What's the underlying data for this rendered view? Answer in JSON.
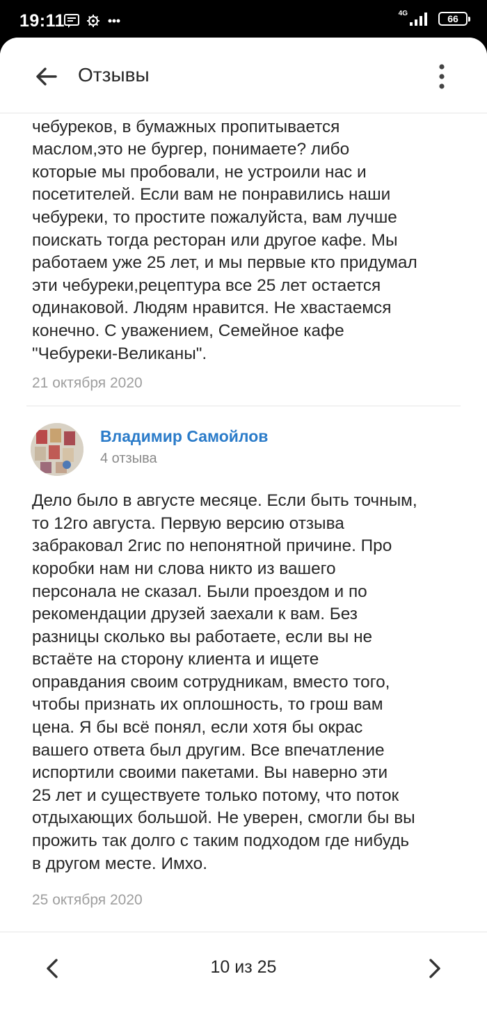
{
  "status_bar": {
    "time": "19:11",
    "network": "4G",
    "battery": "66"
  },
  "header": {
    "title": "Отзывы"
  },
  "reply": {
    "text": "класть, на газету? Нет таких тар больших для\nчебуреков, в бумажных пропитывается\nмаслом,это не бургер, понимаете? либо\nкоторые мы пробовали, не устроили нас и\nпосетителей. Если вам не понравились наши\nчебуреки, то простите пожалуйста, вам лучше\nпоискать тогда ресторан или другое кафе. Мы\nработаем уже 25 лет, и мы первые кто придумал\nэти чебуреки,рецептура все 25 лет остается\nодинаковой. Людям нравится. Не хвастаемся\nконечно. С уважением, Семейное кафе\n\"Чебуреки-Великаны\".",
    "date": "21 октября 2020"
  },
  "review": {
    "author": "Владимир Самойлов",
    "review_count": "4 отзыва",
    "text": "Дело было в августе месяце. Если быть точным,\nто 12го августа. Первую версию отзыва\nзабраковал 2гис по непонятной причине. Про\nкоробки нам ни слова никто из вашего\nперсонала не сказал. Были проездом и по\nрекомендации друзей заехали к вам. Без\nразницы сколько вы работаете, если вы не\nвстаёте на сторону клиента и ищете\nоправдания своим сотрудникам, вместо того,\nчтобы признать их оплошность, то грош вам\nцена. Я бы всё понял, если хотя бы окрас\nвашего ответа был другим. Все впечатление\nиспортили своими пакетами. Вы наверно эти\n25 лет и существуете только потому, что поток\nотдыхающих большой. Не уверен, смогли бы вы\nпрожить так долго с таким подходом где нибудь\nв другом месте. Имхо.",
    "date": "25 октября 2020"
  },
  "pager": {
    "label": "10 из 25"
  },
  "icons": {
    "back": "arrow-left-icon",
    "menu": "more-vertical-icon",
    "prev": "chevron-left-icon",
    "next": "chevron-right-icon"
  },
  "colors": {
    "author_link": "#2a7bc9",
    "text": "#262626",
    "secondary": "#9e9e9e"
  }
}
